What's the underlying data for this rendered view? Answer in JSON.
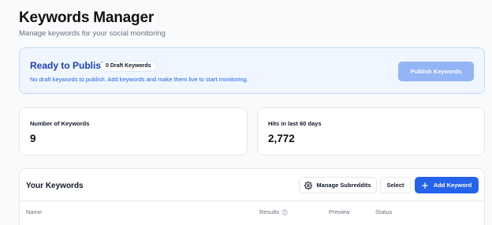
{
  "header": {
    "title": "Keywords Manager",
    "subtitle": "Manage keywords for your social monitoring"
  },
  "publish_banner": {
    "title": "Ready to Publish",
    "badge": "0 Draft Keywords",
    "description": "No draft keywords to publish. Add keywords and make them live to start monitoring.",
    "button_label": "Publish Keywords"
  },
  "stats": [
    {
      "label": "Number of Keywords",
      "value": "9"
    },
    {
      "label": "Hits in last 60 days",
      "value": "2,772"
    }
  ],
  "keywords_panel": {
    "title": "Your Keywords",
    "manage_label": "Manage Subreddits",
    "select_label": "Select",
    "add_label": "Add Keyword",
    "columns": [
      "Name",
      "Results",
      "Preview",
      "Status"
    ]
  },
  "icons": {
    "manage": "gear-icon",
    "add": "plus-icon",
    "results_help": "help-circle-icon"
  },
  "colors": {
    "accent": "#2563eb",
    "banner_bg": "#eff6ff",
    "banner_title": "#1e40af",
    "publish_disabled": "#93b4f5"
  }
}
